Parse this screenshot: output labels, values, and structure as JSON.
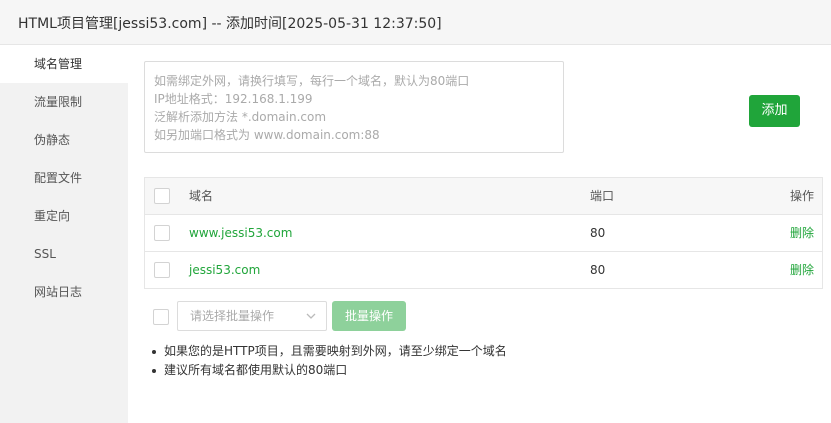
{
  "window": {
    "title": "HTML项目管理[jessi53.com] -- 添加时间[2025-05-31 12:37:50]"
  },
  "sidebar": {
    "items": [
      {
        "label": "域名管理",
        "active": true
      },
      {
        "label": "流量限制"
      },
      {
        "label": "伪静态"
      },
      {
        "label": "配置文件"
      },
      {
        "label": "重定向"
      },
      {
        "label": "SSL"
      },
      {
        "label": "网站日志"
      }
    ]
  },
  "domain_input": {
    "value": "",
    "placeholder_lines": [
      "如需绑定外网，请换行填写，每行一个域名，默认为80端口",
      "IP地址格式：192.168.1.199",
      "泛解析添加方法 *.domain.com",
      "如另加端口格式为 www.domain.com:88"
    ]
  },
  "add_button": {
    "label": "添加"
  },
  "table": {
    "headers": {
      "name": "域名",
      "port": "端口",
      "action": "操作"
    },
    "rows": [
      {
        "name": "www.jessi53.com",
        "port": "80",
        "action": "删除"
      },
      {
        "name": "jessi53.com",
        "port": "80",
        "action": "删除"
      }
    ]
  },
  "batch": {
    "select_placeholder": "请选择批量操作",
    "button_label": "批量操作"
  },
  "tips": [
    "如果您的是HTTP项目，且需要映射到外网，请至少绑定一个域名",
    "建议所有域名都使用默认的80端口"
  ],
  "colors": {
    "accent": "#20a53a",
    "accent_disabled": "#8ed19b"
  }
}
